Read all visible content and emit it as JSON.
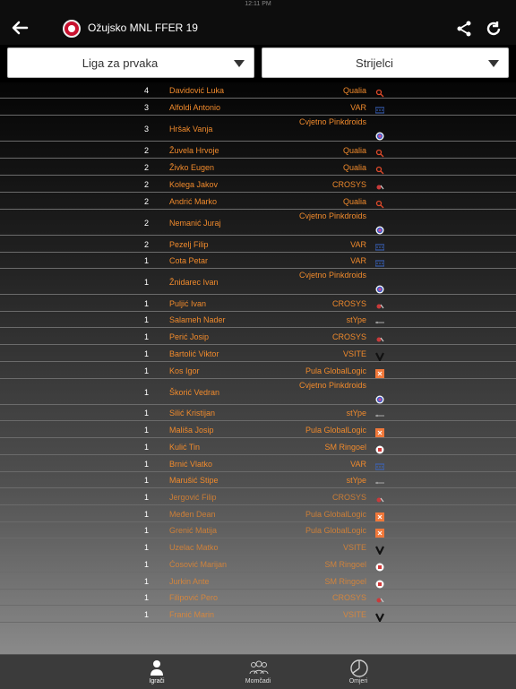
{
  "status": {
    "time": "12:11 PM"
  },
  "header": {
    "title": "Ožujsko MNL FFER 19"
  },
  "filters": {
    "league": "Liga za prvaka",
    "view": "Strijelci"
  },
  "scorers": [
    {
      "goals": "4",
      "name": "Davidović Luka",
      "team": "Qualia",
      "badge": "qualia-icon"
    },
    {
      "goals": "3",
      "name": "Alfoldi Antonio",
      "team": "VAR",
      "badge": "var-icon"
    },
    {
      "goals": "3",
      "name": "Hršak Vanja",
      "team": "Cvjetno Pinkdroids",
      "badge": "cvjetno-icon"
    },
    {
      "goals": "2",
      "name": "Žuvela Hrvoje",
      "team": "Qualia",
      "badge": "qualia-icon"
    },
    {
      "goals": "2",
      "name": "Živko Eugen",
      "team": "Qualia",
      "badge": "qualia-icon"
    },
    {
      "goals": "2",
      "name": "Kolega Jakov",
      "team": "CROSYS",
      "badge": "crosys-icon"
    },
    {
      "goals": "2",
      "name": "Andrić Marko",
      "team": "Qualia",
      "badge": "qualia-icon"
    },
    {
      "goals": "2",
      "name": "Nemanić Juraj",
      "team": "Cvjetno Pinkdroids",
      "badge": "cvjetno-icon"
    },
    {
      "goals": "2",
      "name": "Pezelj Filip",
      "team": "VAR",
      "badge": "var-icon"
    },
    {
      "goals": "1",
      "name": "Cota Petar",
      "team": "VAR",
      "badge": "var-icon"
    },
    {
      "goals": "1",
      "name": "Žnidarec Ivan",
      "team": "Cvjetno Pinkdroids",
      "badge": "cvjetno-icon"
    },
    {
      "goals": "1",
      "name": "Puljić Ivan",
      "team": "CROSYS",
      "badge": "crosys-icon"
    },
    {
      "goals": "1",
      "name": "Salameh Nader",
      "team": "stYpe",
      "badge": "stype-icon"
    },
    {
      "goals": "1",
      "name": "Perić Josip",
      "team": "CROSYS",
      "badge": "crosys-icon"
    },
    {
      "goals": "1",
      "name": "Bartolić Viktor",
      "team": "VSITE",
      "badge": "vsite-icon"
    },
    {
      "goals": "1",
      "name": "Kos Igor",
      "team": "Pula GlobalLogic",
      "badge": "pula-icon"
    },
    {
      "goals": "1",
      "name": "Škorić Vedran",
      "team": "Cvjetno Pinkdroids",
      "badge": "cvjetno-icon"
    },
    {
      "goals": "1",
      "name": "Silić Kristijan",
      "team": "stYpe",
      "badge": "stype-icon"
    },
    {
      "goals": "1",
      "name": "Mališa Josip",
      "team": "Pula GlobalLogic",
      "badge": "pula-icon"
    },
    {
      "goals": "1",
      "name": "Kulić Tin",
      "team": "SM Ringoel",
      "badge": "sm-icon"
    },
    {
      "goals": "1",
      "name": "Brnić Vlatko",
      "team": "VAR",
      "badge": "var-icon"
    },
    {
      "goals": "1",
      "name": "Marušić Stipe",
      "team": "stYpe",
      "badge": "stype-icon"
    },
    {
      "goals": "1",
      "name": "Jergović Filip",
      "team": "CROSYS",
      "badge": "crosys-icon"
    },
    {
      "goals": "1",
      "name": "Međen Dean",
      "team": "Pula GlobalLogic",
      "badge": "pula-icon"
    },
    {
      "goals": "1",
      "name": "Grenić Matija",
      "team": "Pula GlobalLogic",
      "badge": "pula-icon"
    },
    {
      "goals": "1",
      "name": "Uzelac Matko",
      "team": "VSITE",
      "badge": "vsite-icon"
    },
    {
      "goals": "1",
      "name": "Ćosović Marijan",
      "team": "SM Ringoel",
      "badge": "sm-icon"
    },
    {
      "goals": "1",
      "name": "Jurkin Ante",
      "team": "SM Ringoel",
      "badge": "sm-icon"
    },
    {
      "goals": "1",
      "name": "Filipović Pero",
      "team": "CROSYS",
      "badge": "crosys-icon"
    },
    {
      "goals": "1",
      "name": "Franić Marin",
      "team": "VSITE",
      "badge": "vsite-icon"
    }
  ],
  "tabs": [
    {
      "label": "Igrači",
      "icon": "person-icon",
      "active": true
    },
    {
      "label": "Momčadi",
      "icon": "group-icon",
      "active": false
    },
    {
      "label": "Omjeri",
      "icon": "pie-chart-icon",
      "active": false
    }
  ],
  "colors": {
    "accent": "#f08a2c",
    "qualia": "#e04a2a",
    "var": "#3a66c4",
    "pula": "#f0783a",
    "sm": "#d23a3a"
  }
}
